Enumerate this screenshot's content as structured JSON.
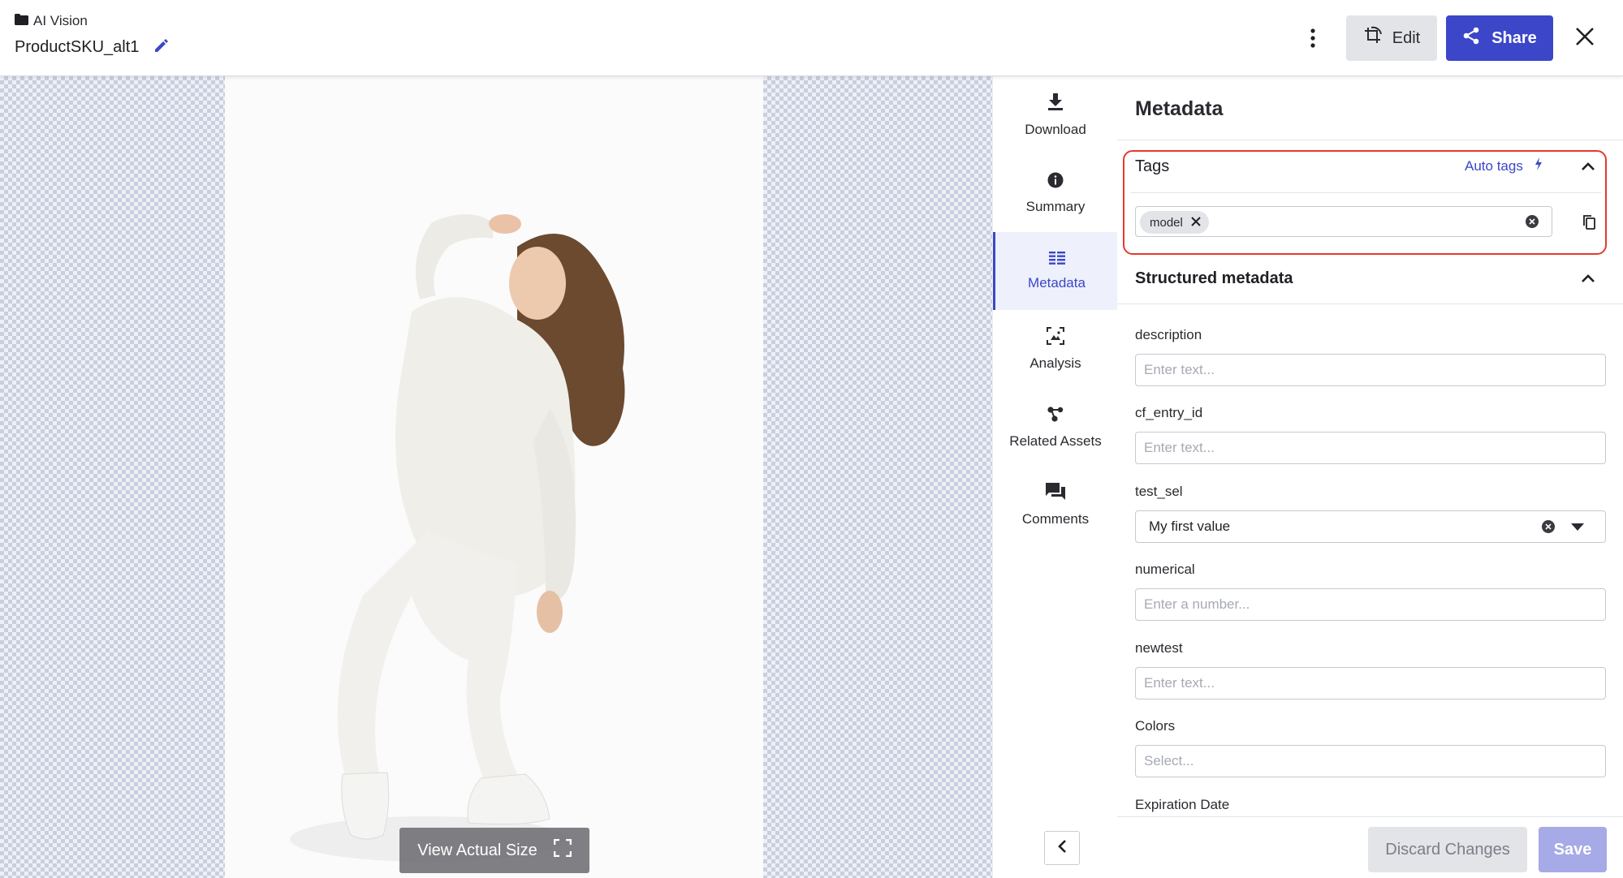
{
  "header": {
    "breadcrumb": "AI Vision",
    "asset_title": "ProductSKU_alt1",
    "edit_label": "Edit",
    "share_label": "Share"
  },
  "preview": {
    "view_actual_size_label": "View Actual Size"
  },
  "side_tabs": [
    {
      "label": "Download",
      "icon": "download-icon"
    },
    {
      "label": "Summary",
      "icon": "info-icon"
    },
    {
      "label": "Metadata",
      "icon": "metadata-list-icon",
      "active": true
    },
    {
      "label": "Analysis",
      "icon": "analysis-icon"
    },
    {
      "label": "Related Assets",
      "icon": "related-assets-icon"
    },
    {
      "label": "Comments",
      "icon": "comments-icon"
    }
  ],
  "metadata": {
    "title": "Metadata",
    "tags": {
      "heading": "Tags",
      "auto_tags_label": "Auto tags",
      "chips": [
        "model"
      ]
    },
    "structured": {
      "heading": "Structured metadata",
      "fields": [
        {
          "label": "description",
          "placeholder": "Enter text..."
        },
        {
          "label": "cf_entry_id",
          "placeholder": "Enter text..."
        },
        {
          "label": "test_sel",
          "value": "My first value"
        },
        {
          "label": "numerical",
          "placeholder": "Enter a number..."
        },
        {
          "label": "newtest",
          "placeholder": "Enter text..."
        },
        {
          "label": "Colors",
          "placeholder": "Select..."
        },
        {
          "label": "Expiration Date"
        }
      ]
    }
  },
  "footer": {
    "discard_label": "Discard Changes",
    "save_label": "Save"
  },
  "colors": {
    "accent": "#3b47c8",
    "highlight_border": "#e33a2e"
  }
}
